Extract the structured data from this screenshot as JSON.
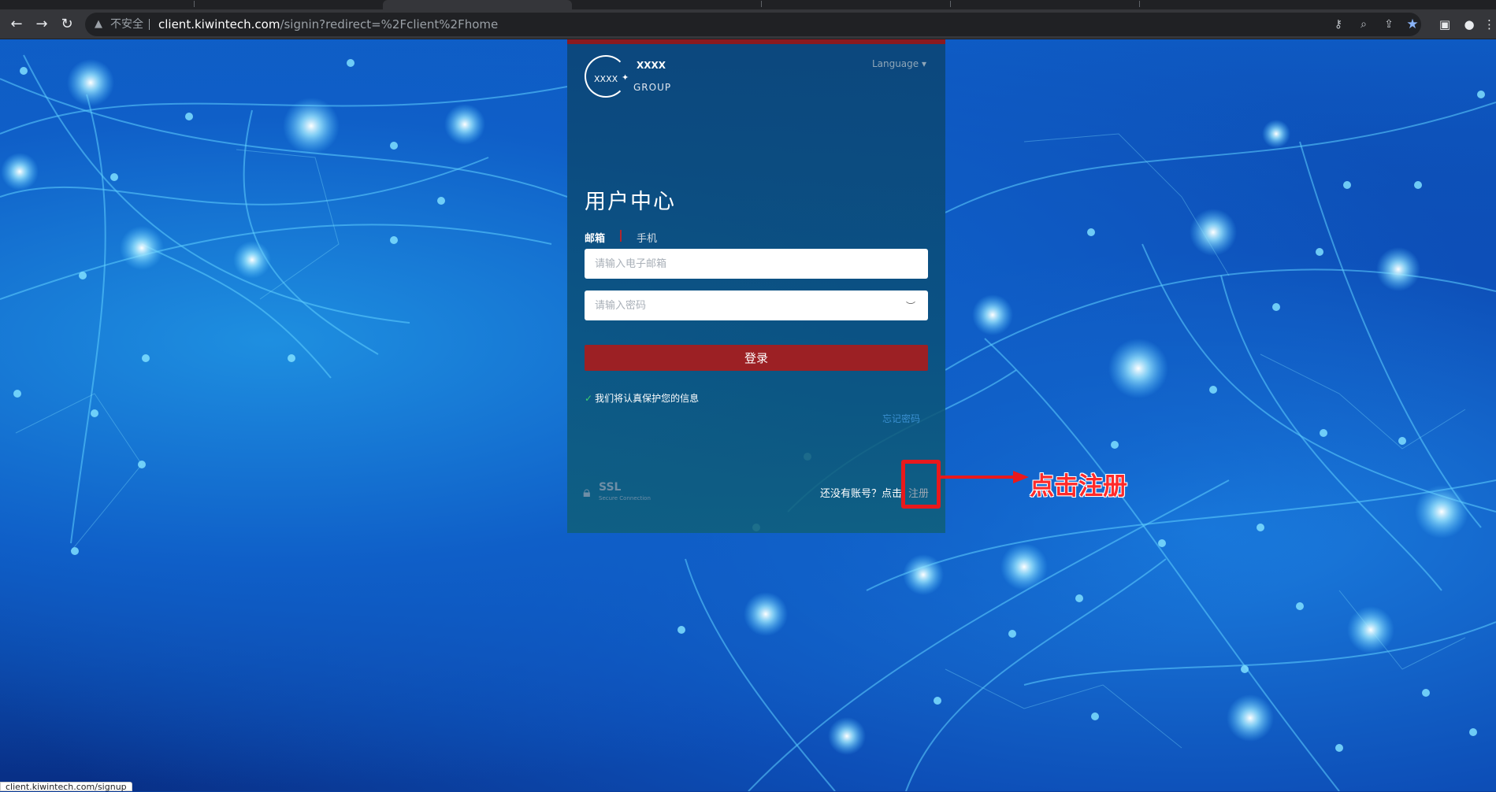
{
  "browser": {
    "security_warning": "不安全",
    "url_host": "client.kiwintech.com",
    "url_path": "/signin?redirect=%2Fclient%2Fhome",
    "status_url": "client.kiwintech.com/signup"
  },
  "card": {
    "logo_text": "XXXX",
    "brand_name": "XXXX",
    "brand_group": "GROUP",
    "language": "Language ▾",
    "title": "用户中心",
    "tabs": [
      "邮箱",
      "手机"
    ],
    "email_placeholder": "请输入电子邮箱",
    "password_placeholder": "请输入密码",
    "login_label": "登录",
    "protect_text": "我们将认真保护您的信息",
    "forgot_label": "忘记密码",
    "ssl_big": "SSL",
    "ssl_small": "Secure Connection",
    "signup_prompt": "还没有账号？点击",
    "signup_label": "注册"
  },
  "annotation": {
    "text": "点击注册",
    "color": "#e8191c"
  }
}
